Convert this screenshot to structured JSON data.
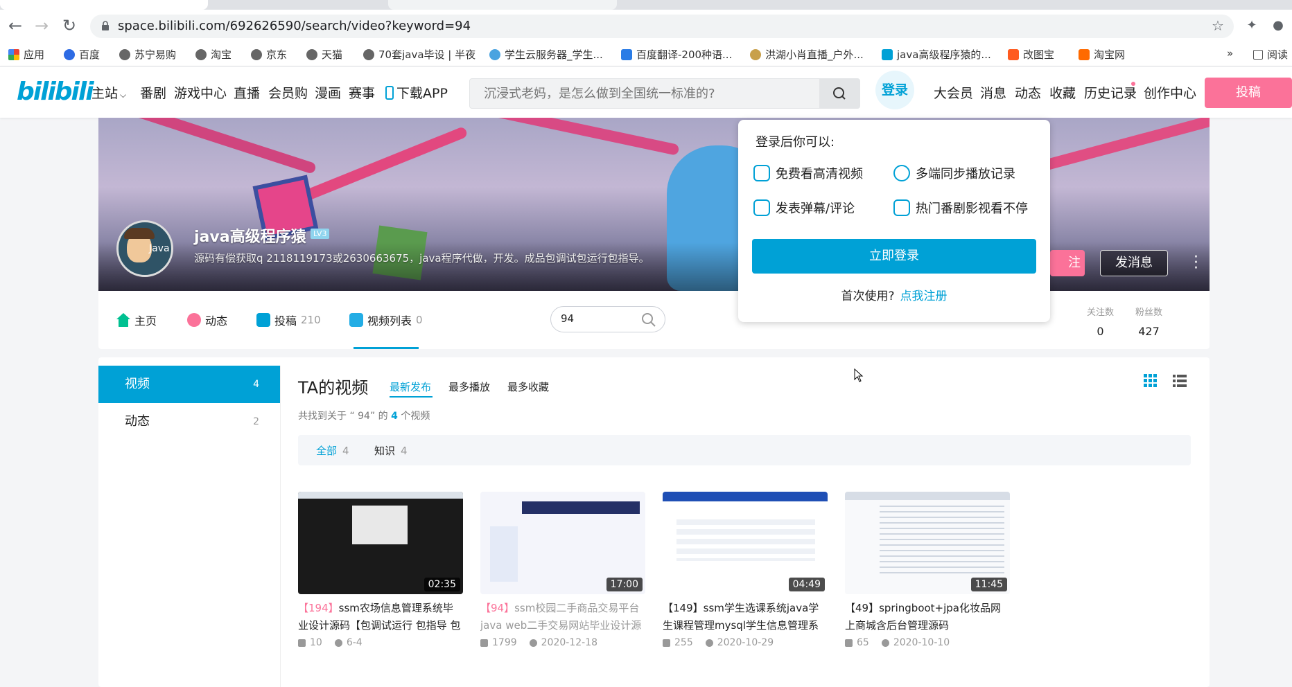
{
  "browser": {
    "url": "space.bilibili.com/692626590/search/video?keyword=94",
    "bookmarks": [
      "应用",
      "百度",
      "苏宁易购",
      "淘宝",
      "京东",
      "天猫",
      "70套java毕设 | 半夜",
      "学生云服务器_学生...",
      "百度翻译-200种语...",
      "洪湖小肖直播_户外...",
      "java高级程序猿的...",
      "改图宝",
      "淘宝网",
      "»",
      "阅读"
    ]
  },
  "header": {
    "logo": "bilibili",
    "nav": [
      "主站",
      "番剧",
      "游戏中心",
      "直播",
      "会员购",
      "漫画",
      "赛事",
      "下载APP"
    ],
    "search_placeholder": "沉浸式老妈，是怎么做到全国统一标准的?",
    "login": "登录",
    "right_nav": [
      "大会员",
      "消息",
      "动态",
      "收藏",
      "历史记录",
      "创作中心"
    ],
    "post": "投稿"
  },
  "profile": {
    "avatar_text": "Java",
    "name": "java高级程序猿",
    "level": "LV3",
    "sign": "源码有偿获取q 2118119173或2630663675，java程序代做，开发。成品包调试包运行包指导。",
    "follow": "注",
    "message": "发消息"
  },
  "subnav": {
    "home": "主页",
    "dynamic": "动态",
    "uploads": "投稿",
    "uploads_count": "210",
    "playlists": "视频列表",
    "playlists_count": "0",
    "search_value": "94",
    "following_label": "关注数",
    "following": "0",
    "fans_label": "粉丝数",
    "fans": "427"
  },
  "sidebar": [
    {
      "label": "视频",
      "count": "4"
    },
    {
      "label": "动态",
      "count": "2"
    }
  ],
  "main": {
    "title": "TA的视频",
    "orders": [
      "最新发布",
      "最多播放",
      "最多收藏"
    ],
    "found_prefix": "共找到关于 “ 94” 的",
    "found_count": "4",
    "found_suffix": "个视频",
    "filters": [
      {
        "label": "全部",
        "count": "4"
      },
      {
        "label": "知识",
        "count": "4"
      }
    ]
  },
  "videos": [
    {
      "duration": "02:35",
      "title_num": "【194】",
      "title": "ssm农场信息管理系统毕业设计源码【包调试运行 包指导 包安",
      "plays": "10",
      "date": "6-4"
    },
    {
      "duration": "17:00",
      "title_num": "【94】",
      "title": "ssm校园二手商品交易平台java web二手交易网站毕业设计源",
      "plays": "1799",
      "date": "2020-12-18"
    },
    {
      "duration": "04:49",
      "title_num": "【149】",
      "title": "ssm学生选课系统java学生课程管理mysql学生信息管理系统",
      "plays": "255",
      "date": "2020-10-29"
    },
    {
      "duration": "11:45",
      "title_num": "【49】",
      "title": "springboot+jpa化妆品网上商城含后台管理源码",
      "plays": "65",
      "date": "2020-10-10"
    }
  ],
  "popup": {
    "heading": "登录后你可以:",
    "features": [
      "免费看高清视频",
      "多端同步播放记录",
      "发表弹幕/评论",
      "热门番剧影视看不停"
    ],
    "login_now": "立即登录",
    "first_use": "首次使用?",
    "register": "点我注册"
  },
  "colors": {
    "accent": "#00a1d6",
    "pink": "#fb7299"
  }
}
